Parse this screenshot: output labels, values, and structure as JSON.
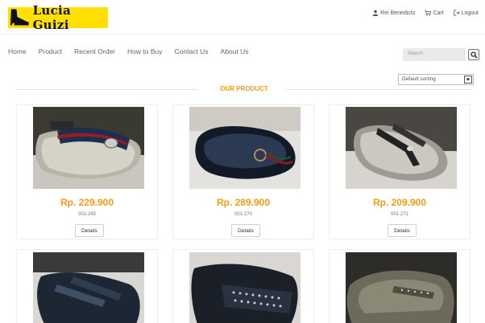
{
  "brand": {
    "name": "Lucia Guizi"
  },
  "topnav": {
    "user": "Rei Benedicts",
    "cart": "Cart",
    "logout": "Logout"
  },
  "nav": {
    "items": [
      "Home",
      "Product",
      "Recent Order",
      "How to Buy",
      "Contact Us",
      "About Us"
    ]
  },
  "search": {
    "placeholder": "Search"
  },
  "sort": {
    "selected": "Default sorting"
  },
  "section": {
    "title": "OUR PRODUCT"
  },
  "products": [
    {
      "price": "Rp. 229.900",
      "code": "001-245",
      "button": "Details"
    },
    {
      "price": "Rp. 289.900",
      "code": "001-270",
      "button": "Details"
    },
    {
      "price": "Rp. 209.900",
      "code": "001-271",
      "button": "Details"
    }
  ],
  "colors": {
    "accent": "#f39c12",
    "brand_bg": "#ffe000"
  },
  "icons": [
    "boot-logo-icon",
    "user-icon",
    "cart-icon",
    "logout-icon",
    "search-icon",
    "dropdown-arrow-icon"
  ]
}
